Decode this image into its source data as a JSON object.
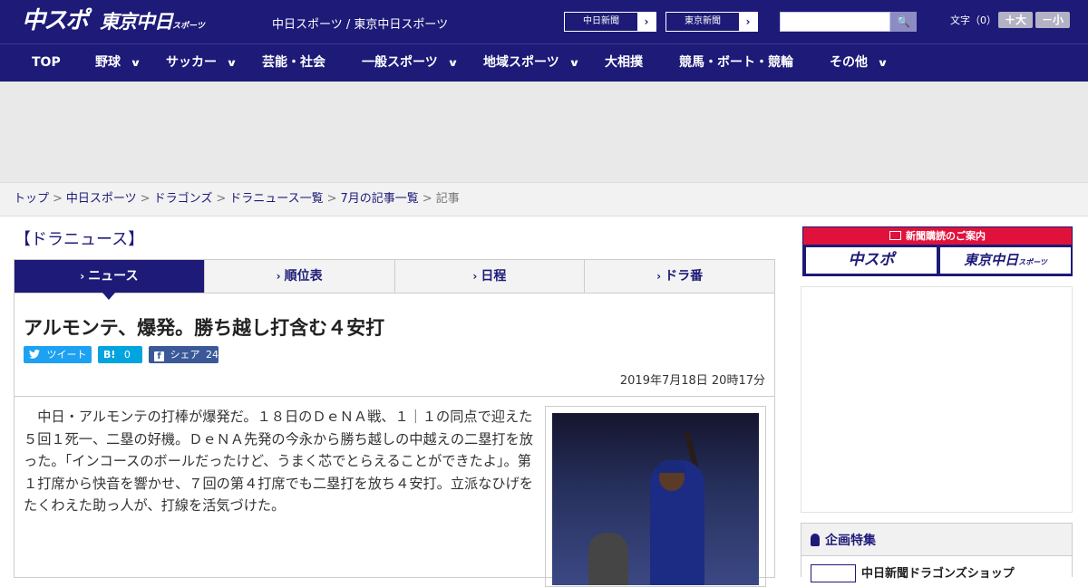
{
  "header": {
    "logo_chunichi": "中スポ",
    "logo_tokyo": "東京中日",
    "logo_tokyo_sub": "スポーツ",
    "site_names": "中日スポーツ / 東京中日スポーツ",
    "ext_links": [
      "中日新聞",
      "東京新聞"
    ],
    "ext_arrow": "›",
    "search_placeholder": "",
    "search_icon": "🔍",
    "font_label": "文字（0）",
    "font_bigger": "＋大",
    "font_smaller": "－小"
  },
  "nav": {
    "items": [
      {
        "label": "TOP",
        "has_dropdown": false
      },
      {
        "label": "野球",
        "has_dropdown": true
      },
      {
        "label": "サッカー",
        "has_dropdown": true
      },
      {
        "label": "芸能・社会",
        "has_dropdown": false
      },
      {
        "label": "一般スポーツ",
        "has_dropdown": true
      },
      {
        "label": "地域スポーツ",
        "has_dropdown": true
      },
      {
        "label": "大相撲",
        "has_dropdown": false
      },
      {
        "label": "競馬・ボート・競輪",
        "has_dropdown": false
      },
      {
        "label": "その他",
        "has_dropdown": true
      }
    ],
    "chevron": "∨"
  },
  "breadcrumb": {
    "links": [
      "トップ",
      "中日スポーツ",
      "ドラゴンズ",
      "ドラニュース一覧",
      "7月の記事一覧"
    ],
    "current": "記事",
    "separator": ">"
  },
  "section_title": "【ドラニュース】",
  "tabs": [
    {
      "label": "ニュース",
      "active": true
    },
    {
      "label": "順位表",
      "active": false
    },
    {
      "label": "日程",
      "active": false
    },
    {
      "label": "ドラ番",
      "active": false
    }
  ],
  "tab_arrow": "›",
  "article": {
    "title": "アルモンテ、爆発。勝ち越し打含む４安打",
    "share": {
      "tweet": "ツイート",
      "hatena_icon": "B!",
      "hatena_count": "0",
      "facebook_label": "シェア",
      "facebook_count": "24"
    },
    "date": "2019年7月18日 20時17分",
    "body": "　中日・アルモンテの打棒が爆発だ。１８日のＤｅＮＡ戦、１｜１の同点で迎えた５回１死一、二塁の好機。ＤｅＮＡ先発の今永から勝ち越しの中越えの二塁打を放った。「インコースのボールだったけど、うまく芯でとらえることができたよ」。第１打席から快音を響かせ、７回の第４打席でも二塁打を放ち４安打。立派なひげをたくわえた助っ人が、打線を活気づけた。"
  },
  "sidebar": {
    "subscribe_head": "新聞購読のご案内",
    "subscribe_logos": [
      "中スポ",
      "東京中日"
    ],
    "subscribe_logo_sub": "スポーツ",
    "feature_title": "企画特集",
    "feature_item": "中日新聞ドラゴンズショップ"
  },
  "colors": {
    "brand": "#1d1a78",
    "accent_red": "#e0123b",
    "twitter": "#1da1f2",
    "hatena": "#00a4de",
    "facebook": "#3b5998"
  }
}
